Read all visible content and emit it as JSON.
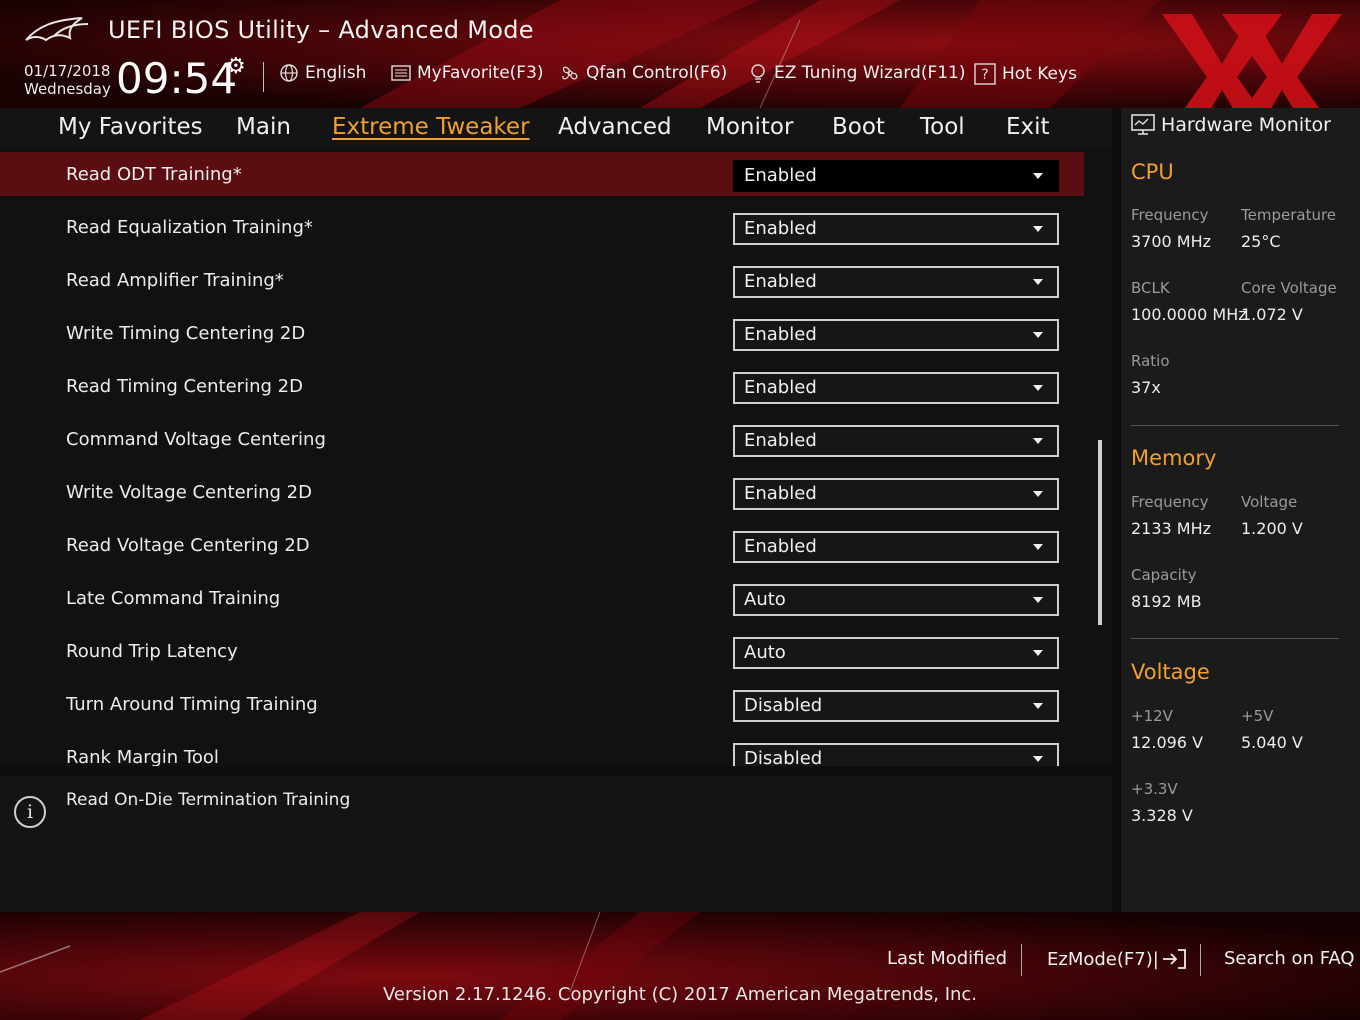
{
  "header": {
    "title": "UEFI BIOS Utility – Advanced Mode",
    "date": "01/17/2018",
    "weekday": "Wednesday",
    "time": "09:54",
    "toolbar": [
      {
        "label": "English",
        "icon": "globe-icon"
      },
      {
        "label": "MyFavorite(F3)",
        "icon": "favorite-list-icon"
      },
      {
        "label": "Qfan Control(F6)",
        "icon": "fan-icon"
      },
      {
        "label": "EZ Tuning Wizard(F11)",
        "icon": "lightbulb-icon"
      },
      {
        "label": "Hot Keys",
        "icon": "help-question-icon"
      }
    ]
  },
  "nav": {
    "tabs": [
      "My Favorites",
      "Main",
      "Extreme Tweaker",
      "Advanced",
      "Monitor",
      "Boot",
      "Tool",
      "Exit"
    ],
    "active": "Extreme Tweaker"
  },
  "settings": [
    {
      "label": "Read ODT Training*",
      "value": "Enabled"
    },
    {
      "label": "Read Equalization Training*",
      "value": "Enabled"
    },
    {
      "label": "Read Amplifier Training*",
      "value": "Enabled"
    },
    {
      "label": "Write Timing Centering 2D",
      "value": "Enabled"
    },
    {
      "label": "Read Timing Centering 2D",
      "value": "Enabled"
    },
    {
      "label": "Command Voltage Centering",
      "value": "Enabled"
    },
    {
      "label": "Write Voltage Centering 2D",
      "value": "Enabled"
    },
    {
      "label": "Read Voltage Centering 2D",
      "value": "Enabled"
    },
    {
      "label": "Late Command Training",
      "value": "Auto"
    },
    {
      "label": "Round Trip Latency",
      "value": "Auto"
    },
    {
      "label": "Turn Around Timing Training",
      "value": "Disabled"
    },
    {
      "label": "Rank Margin Tool",
      "value": "Disabled"
    }
  ],
  "info": {
    "text": "Read On-Die Termination Training"
  },
  "hardware_monitor": {
    "title": "Hardware Monitor",
    "cpu": {
      "heading": "CPU",
      "frequency_label": "Frequency",
      "frequency": "3700 MHz",
      "temperature_label": "Temperature",
      "temperature": "25°C",
      "bclk_label": "BCLK",
      "bclk": "100.0000 MHz",
      "core_voltage_label": "Core Voltage",
      "core_voltage": "1.072 V",
      "ratio_label": "Ratio",
      "ratio": "37x"
    },
    "memory": {
      "heading": "Memory",
      "frequency_label": "Frequency",
      "frequency": "2133 MHz",
      "voltage_label": "Voltage",
      "voltage": "1.200 V",
      "capacity_label": "Capacity",
      "capacity": "8192 MB"
    },
    "voltage": {
      "heading": "Voltage",
      "v12_label": "+12V",
      "v12": "12.096 V",
      "v5_label": "+5V",
      "v5": "5.040 V",
      "v33_label": "+3.3V",
      "v33": "3.328 V"
    }
  },
  "footer": {
    "last_modified": "Last Modified",
    "ezmode": "EzMode(F7)|",
    "search_faq": "Search on FAQ",
    "version": "Version 2.17.1246. Copyright (C) 2017 American Megatrends, Inc."
  },
  "colors": {
    "accent": "#f0a030",
    "selected_row": "#5a0e11",
    "brand_red": "#c01018"
  }
}
